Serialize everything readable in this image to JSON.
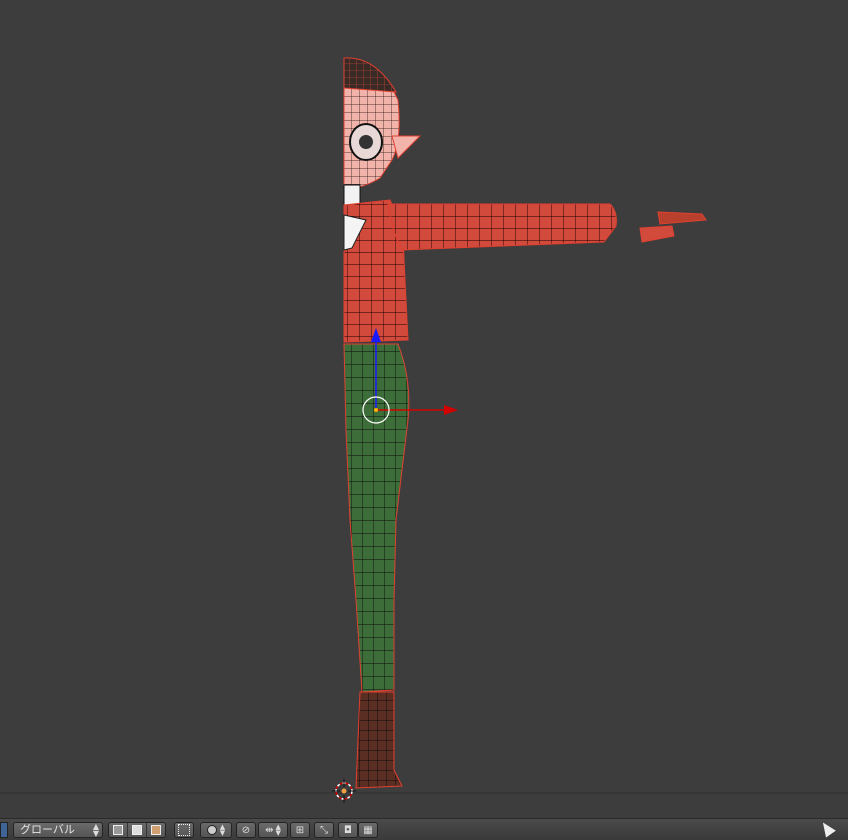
{
  "viewport": {
    "background_color": "#3d3d3d",
    "model": {
      "description_colors": {
        "skin": "#f2a8a0",
        "hair": "#4a2c22",
        "shirt": "#d14a3c",
        "pants": "#3d6e3a",
        "boots": "#5a2e22",
        "wire": "#111111"
      }
    },
    "gizmo": {
      "x_axis_color": "#d40000",
      "z_axis_color": "#1a1aff"
    }
  },
  "toolbar": {
    "orientation_label": "グローバル",
    "icons": {
      "viewport_shading": [
        "wireframe-cube-icon",
        "solid-cube-icon",
        "texture-cube-icon"
      ],
      "select": "border-select-icon",
      "pivot": "pivot-point-icon",
      "snap": "snap-icon",
      "snap_element": "snap-element-icon",
      "proportional": "proportional-edit-icon",
      "transform": "manipulator-icon",
      "render": "camera-render-icon",
      "animation": "clapper-icon"
    }
  }
}
